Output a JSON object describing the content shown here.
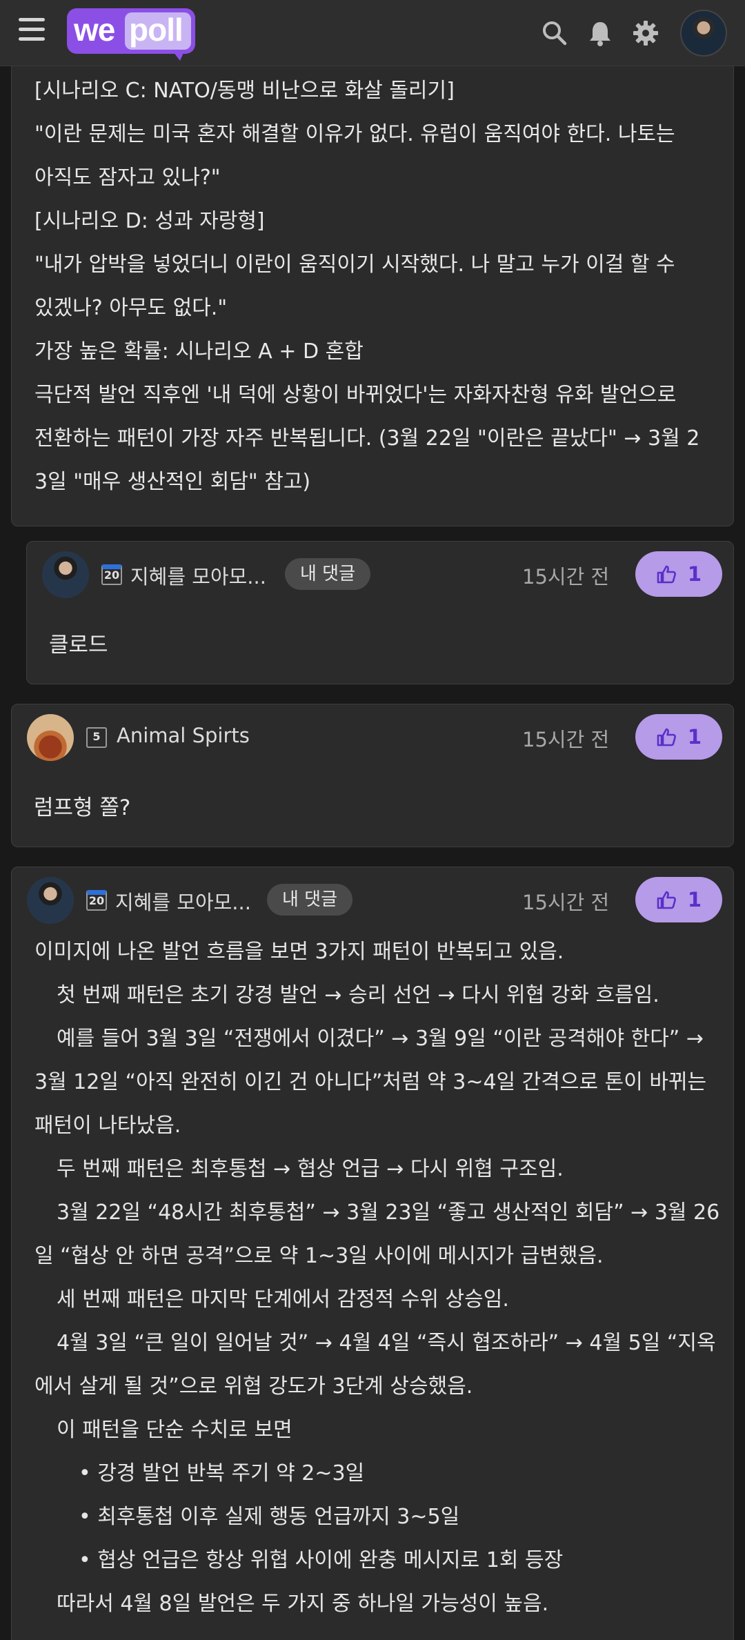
{
  "header": {
    "logo_we": "we",
    "logo_poll": "poll"
  },
  "post_lines": [
    "[시나리오 C: NATO/동맹 비난으로 화살 돌리기]",
    "\"이란 문제는 미국 혼자 해결할 이유가 없다. 유럽이 움직여야 한다. 나토는",
    "아직도 잠자고 있나?\"",
    "[시나리오 D: 성과 자랑형]",
    "\"내가 압박을 넣었더니 이란이 움직이기 시작했다. 나 말고 누가 이걸 할 수",
    "있겠나? 아무도 없다.\"",
    "가장 높은 확률: 시나리오 A + D 혼합",
    "극단적 발언 직후엔 '내 덕에 상황이 바뀌었다'는 자화자찬형 유화 발언으로",
    "전환하는 패턴이 가장 자주 반복됩니다. (3월 22일 \"이란은 끝났다\" → 3월 2",
    "3일 \"매우 생산적인 회담\" 참고)"
  ],
  "comments": [
    {
      "level": "20",
      "username": "지혜를 모아모...",
      "badge": "내 댓글",
      "time": "15시간 전",
      "likes": "1",
      "text": "클로드"
    },
    {
      "level": "5",
      "username": "Animal Spirts",
      "time": "15시간 전",
      "likes": "1",
      "text": "럼프형 쫄?"
    },
    {
      "level": "20",
      "username": "지혜를 모아모...",
      "badge": "내 댓글",
      "time": "15시간 전",
      "likes": "1",
      "lines": [
        "이미지에 나온 발언 흐름을 보면 3가지 패턴이 반복되고 있음.",
        "첫 번째 패턴은 초기 강경 발언 → 승리 선언 → 다시 위협 강화 흐름임.",
        "예를 들어 3월 3일 “전쟁에서 이겼다” → 3월 9일 “이란 공격해야 한다” →",
        "3월 12일 “아직 완전히 이긴 건 아니다”처럼 약 3~4일 간격으로 톤이 바뀌는",
        "패턴이 나타났음.",
        "두 번째 패턴은 최후통첩 → 협상 언급 → 다시 위협 구조임.",
        "3월 22일 “48시간 최후통첩” → 3월 23일 “좋고 생산적인 회담” → 3월 26",
        "일 “협상 안 하면 공격”으로 약 1~3일 사이에 메시지가 급변했음.",
        "세 번째 패턴은 마지막 단계에서 감정적 수위 상승임.",
        "4월 3일 “큰 일이 일어날 것” → 4월 4일 “즉시 협조하라” → 4월 5일 “지옥",
        "에서 살게 될 것”으로 위협 강도가 3단계 상승했음.",
        "이 패턴을 단순 수치로 보면",
        "• 강경 발언 반복 주기 약 2~3일",
        "• 최후통첩 이후 실제 행동 언급까지 3~5일",
        "• 협상 언급은 항상 위협 사이에 완충 메시지로 1회 등장",
        "따라서 4월 8일 발언은 두 가지 중 하나일 가능성이 높음."
      ]
    }
  ]
}
